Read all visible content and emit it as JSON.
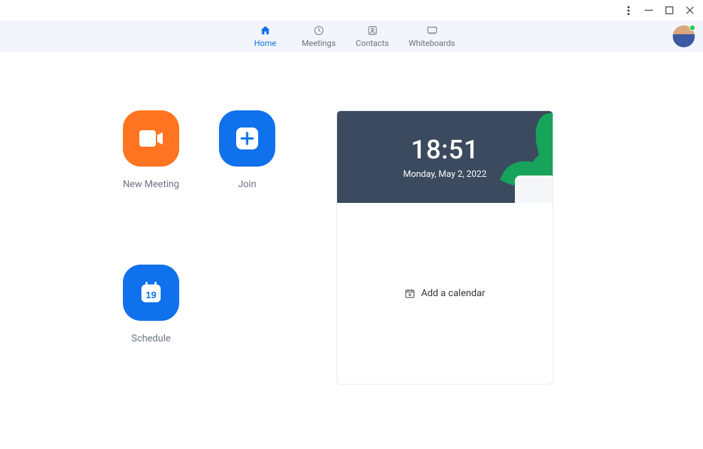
{
  "tabs": {
    "home": "Home",
    "meetings": "Meetings",
    "contacts": "Contacts",
    "whiteboards": "Whiteboards"
  },
  "actions": {
    "new_meeting": "New Meeting",
    "join": "Join",
    "schedule": "Schedule",
    "schedule_day": "19"
  },
  "clock": {
    "time": "18:51",
    "date": "Monday, May 2, 2022"
  },
  "calendar": {
    "add_label": "Add a calendar"
  }
}
